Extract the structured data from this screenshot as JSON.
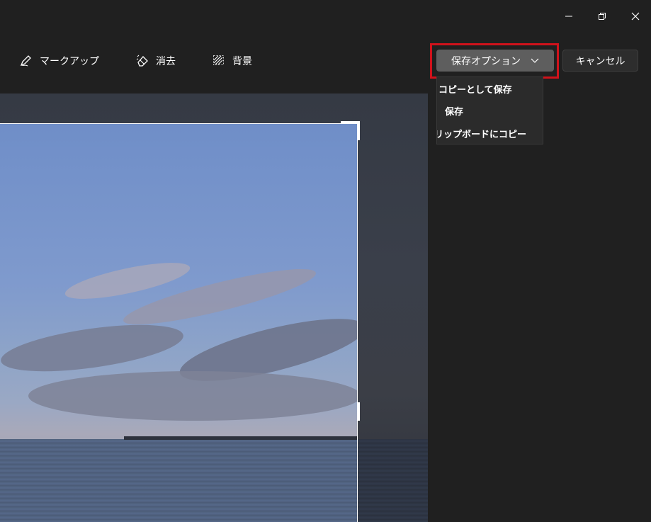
{
  "window_controls": {
    "minimize_icon": "minimize-icon",
    "restore_icon": "restore-icon",
    "close_icon": "close-icon"
  },
  "toolbar": {
    "markup_label": "マークアップ",
    "erase_label": "消去",
    "background_label": "背景",
    "save_options_label": "保存オプション",
    "cancel_label": "キャンセル"
  },
  "save_menu": {
    "items": [
      {
        "label": "コピーとして保存"
      },
      {
        "label": "保存"
      },
      {
        "label": "リップボードにコピー"
      }
    ]
  },
  "colors": {
    "highlight": "#d0121b",
    "save_button_bg": "#5e5e5e",
    "app_bg": "#202020"
  }
}
